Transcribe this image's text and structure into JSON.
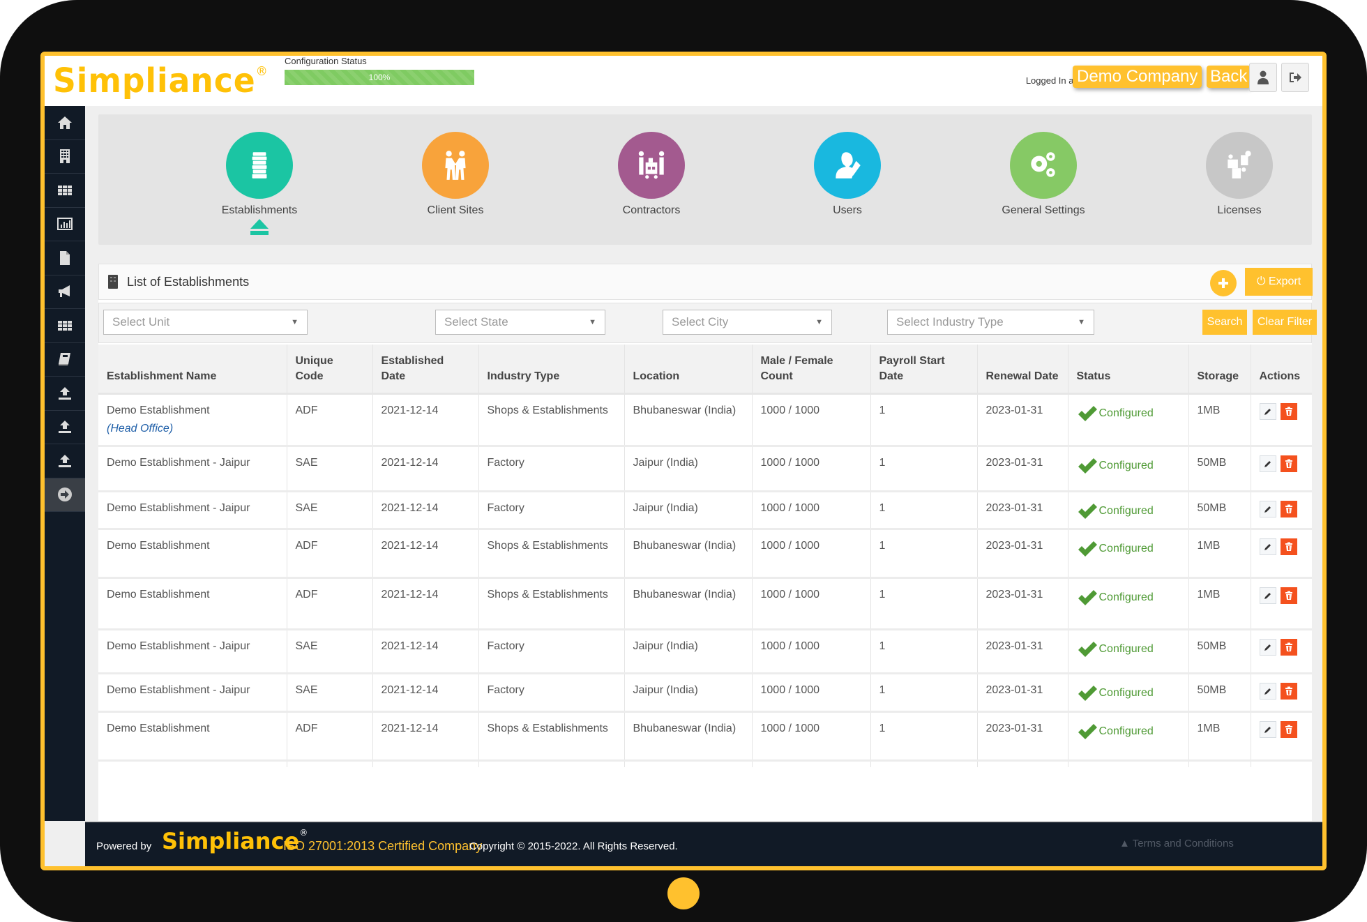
{
  "header": {
    "logo_text": "Simpliance",
    "logo_mark": "®",
    "config_status_label": "Configuration Status",
    "config_progress_percent": 100,
    "config_progress_label": "100%",
    "logged_in_label": "Logged In as",
    "company_name": "Demo Company",
    "back_label": "Back",
    "profile_icon": "user-icon",
    "logout_icon": "logout-icon"
  },
  "sidebar": {
    "items": [
      {
        "icon": "home-icon"
      },
      {
        "icon": "building-icon"
      },
      {
        "icon": "grid-icon"
      },
      {
        "icon": "bar-chart-icon"
      },
      {
        "icon": "document-icon"
      },
      {
        "icon": "megaphone-icon"
      },
      {
        "icon": "grid-icon"
      },
      {
        "icon": "book-icon"
      },
      {
        "icon": "upload-icon"
      },
      {
        "icon": "upload-icon"
      },
      {
        "icon": "upload-icon"
      },
      {
        "icon": "arrow-right-circle-icon",
        "active": true
      }
    ]
  },
  "modules": [
    {
      "label": "Establishments",
      "icon": "establishments-icon",
      "color": "#1bc5a3",
      "selected": true
    },
    {
      "label": "Client Sites",
      "icon": "client-sites-icon",
      "color": "#f8a33b"
    },
    {
      "label": "Contractors",
      "icon": "contractors-icon",
      "color": "#a35a8f"
    },
    {
      "label": "Users",
      "icon": "users-icon",
      "color": "#19b8df"
    },
    {
      "label": "General Settings",
      "icon": "gears-icon",
      "color": "#86c965"
    },
    {
      "label": "Licenses",
      "icon": "puzzle-icon",
      "color": "#c7c7c7"
    }
  ],
  "list": {
    "title": "List of Establishments",
    "export_label": "Export",
    "filters": {
      "unit_placeholder": "Select Unit",
      "state_placeholder": "Select State",
      "city_placeholder": "Select City",
      "industry_placeholder": "Select Industry Type",
      "search_label": "Search",
      "clear_label": "Clear Filter"
    },
    "columns": [
      "Establishment Name",
      "Unique Code",
      "Established Date",
      "Industry Type",
      "Location",
      "Male / Female Count",
      "Payroll Start Date",
      "Renewal Date",
      "Status",
      "Storage",
      "Actions"
    ],
    "rows": [
      {
        "name": "Demo Establishment",
        "tag": "(Head Office)",
        "code": "ADF",
        "established": "2021-12-14",
        "industry": "Shops & Establishments",
        "location": "Bhubaneswar (India)",
        "count": "1000 / 1000",
        "payroll": "1",
        "renewal": "2023-01-31",
        "status": "Configured",
        "storage": "1MB"
      },
      {
        "name": "Demo Establishment - Jaipur",
        "code": "SAE",
        "established": "2021-12-14",
        "industry": "Factory",
        "location": "Jaipur (India)",
        "count": "1000 / 1000",
        "payroll": "1",
        "renewal": "2023-01-31",
        "status": "Configured",
        "storage": "50MB"
      },
      {
        "name": "Demo Establishment - Jaipur",
        "code": "SAE",
        "established": "2021-12-14",
        "industry": "Factory",
        "location": "Jaipur (India)",
        "count": "1000 / 1000",
        "payroll": "1",
        "renewal": "2023-01-31",
        "status": "Configured",
        "storage": "50MB"
      },
      {
        "name": "Demo Establishment",
        "code": "ADF",
        "established": "2021-12-14",
        "industry": "Shops & Establishments",
        "location": "Bhubaneswar (India)",
        "count": "1000 / 1000",
        "payroll": "1",
        "renewal": "2023-01-31",
        "status": "Configured",
        "storage": "1MB"
      },
      {
        "name": "Demo Establishment",
        "code": "ADF",
        "established": "2021-12-14",
        "industry": "Shops & Establishments",
        "location": "Bhubaneswar (India)",
        "count": "1000 / 1000",
        "payroll": "1",
        "renewal": "2023-01-31",
        "status": "Configured",
        "storage": "1MB"
      },
      {
        "name": "Demo Establishment - Jaipur",
        "code": "SAE",
        "established": "2021-12-14",
        "industry": "Factory",
        "location": "Jaipur (India)",
        "count": "1000 / 1000",
        "payroll": "1",
        "renewal": "2023-01-31",
        "status": "Configured",
        "storage": "50MB"
      },
      {
        "name": "Demo Establishment - Jaipur",
        "code": "SAE",
        "established": "2021-12-14",
        "industry": "Factory",
        "location": "Jaipur (India)",
        "count": "1000 / 1000",
        "payroll": "1",
        "renewal": "2023-01-31",
        "status": "Configured",
        "storage": "50MB"
      },
      {
        "name": "Demo Establishment",
        "code": "ADF",
        "established": "2021-12-14",
        "industry": "Shops & Establishments",
        "location": "Bhubaneswar (India)",
        "count": "1000 / 1000",
        "payroll": "1",
        "renewal": "2023-01-31",
        "status": "Configured",
        "storage": "1MB"
      }
    ]
  },
  "footer": {
    "powered_by": "Powered by",
    "logo_text": "Simpliance",
    "logo_mark": "®",
    "iso": "ISO 27001:2013 Certified Company",
    "copyright": "Copyright © 2015-2022. All Rights Reserved.",
    "terms": "Terms and Conditions"
  },
  "colors": {
    "accent": "#ffc12e",
    "sidebar": "#111a26",
    "status_ok": "#4f9a35",
    "delete": "#f4511e"
  }
}
